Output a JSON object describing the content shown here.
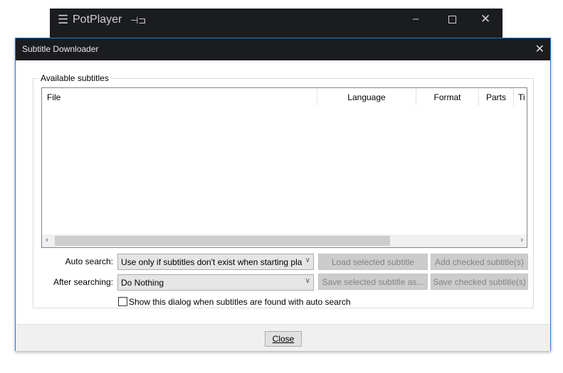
{
  "player": {
    "title": "PotPlayer",
    "menu_icon": "hamburger-icon",
    "pin_icon": "pin-icon"
  },
  "dialog": {
    "title": "Subtitle Downloader",
    "group_label": "Available subtitles",
    "columns": [
      "File",
      "Language",
      "Format",
      "Parts",
      "Ti"
    ],
    "auto_search": {
      "label": "Auto search:",
      "value": "Use only if subtitles don't exist when starting pla"
    },
    "after_searching": {
      "label": "After searching:",
      "value": "Do Nothing"
    },
    "buttons": {
      "load": "Load selected subtitle",
      "add": "Add checked subtitle(s)",
      "save_sel": "Save selected subtitle as...",
      "save_chk": "Save checked subtitle(s)"
    },
    "checkbox": {
      "label": "Show this dialog when subtitles are found with auto search",
      "checked": false
    },
    "close": "Close"
  }
}
